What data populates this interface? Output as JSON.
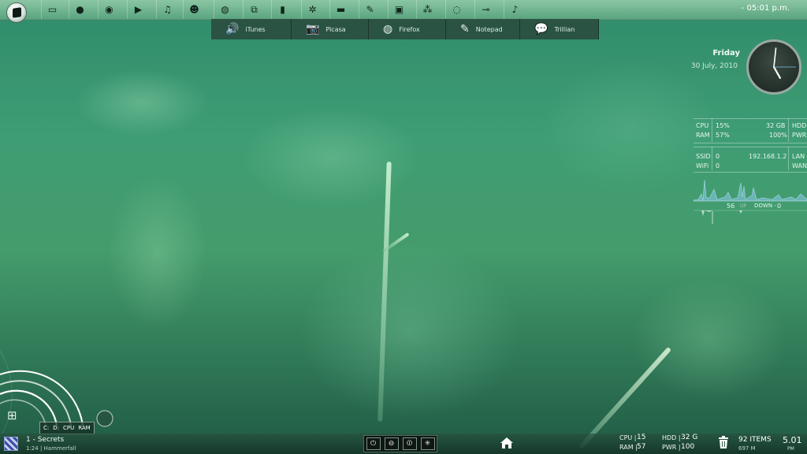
{
  "topbar": {
    "icons": [
      {
        "name": "folder-icon",
        "glyph": "▭"
      },
      {
        "name": "firefox-globe-icon",
        "glyph": "●"
      },
      {
        "name": "at-icon",
        "glyph": "◉"
      },
      {
        "name": "play-icon",
        "glyph": "▶"
      },
      {
        "name": "music-note-icon",
        "glyph": "♫"
      },
      {
        "name": "users-icon",
        "glyph": "☻"
      },
      {
        "name": "globe-icon",
        "glyph": "◍"
      },
      {
        "name": "windows-icon",
        "glyph": "⧉"
      },
      {
        "name": "mouse-icon",
        "glyph": "▮"
      },
      {
        "name": "gear-icon",
        "glyph": "✲"
      },
      {
        "name": "book-icon",
        "glyph": "▬"
      },
      {
        "name": "pen-icon",
        "glyph": "✎"
      },
      {
        "name": "photoshop-icon",
        "glyph": "▣"
      },
      {
        "name": "network-icon",
        "glyph": "⁂"
      },
      {
        "name": "refresh-icon",
        "glyph": "◌"
      },
      {
        "name": "usb-icon",
        "glyph": "⊸"
      },
      {
        "name": "itunes-icon",
        "glyph": "♪"
      }
    ],
    "time_dash": "-",
    "time": "05:01 p.m."
  },
  "dock": {
    "items": [
      {
        "label": "iTunes",
        "icon": "🔊"
      },
      {
        "label": "Picasa",
        "icon": "📷"
      },
      {
        "label": "Firefox",
        "icon": "◍"
      },
      {
        "label": "Notepad",
        "icon": "✎"
      },
      {
        "label": "Trillian",
        "icon": "💬"
      }
    ]
  },
  "clock_widget": {
    "day": "Friday",
    "date": "30 July, 2010",
    "hour": 5,
    "minute": 1
  },
  "stats": {
    "cpu_label": "CPU",
    "cpu_value": "15%",
    "ram_label": "RAM",
    "ram_value": "57%",
    "hdd_value": "32 GB",
    "hdd_label": "HDD",
    "pwr_value": "100%",
    "pwr_label": "PWR",
    "ssid_label": "SSID",
    "ssid_value": "0",
    "wifi_label": "WiFi",
    "wifi_value": "0",
    "ip": "192.168.1.2",
    "lan_label": "LAN",
    "wan_label": "WAN",
    "up_value": "56",
    "up_label": "UP",
    "down_label": "DOWN -",
    "down_value": "0"
  },
  "rings_widget": {
    "labels": [
      "C:",
      "D:",
      "CPU",
      "RAM"
    ]
  },
  "bottombar": {
    "now_playing_title": "1 - Secrets",
    "now_playing_sub": "1:24 | Hammerfall",
    "cpu_label": "CPU |",
    "cpu_value": "15",
    "ram_label": "RAM |",
    "ram_value": "57",
    "hdd_label": "HDD |",
    "hdd_value": "32 G",
    "pwr_label": "PWR |",
    "pwr_value": "100",
    "items_count": "92 ITEMS",
    "items_size": "697 M",
    "time": "5.01",
    "ampm": "PM"
  },
  "power_buttons": [
    {
      "name": "power-icon",
      "glyph": "⏻"
    },
    {
      "name": "logoff-icon",
      "glyph": "⊖"
    },
    {
      "name": "restart-icon",
      "glyph": "⏼"
    },
    {
      "name": "sleep-icon",
      "glyph": "✳"
    }
  ]
}
